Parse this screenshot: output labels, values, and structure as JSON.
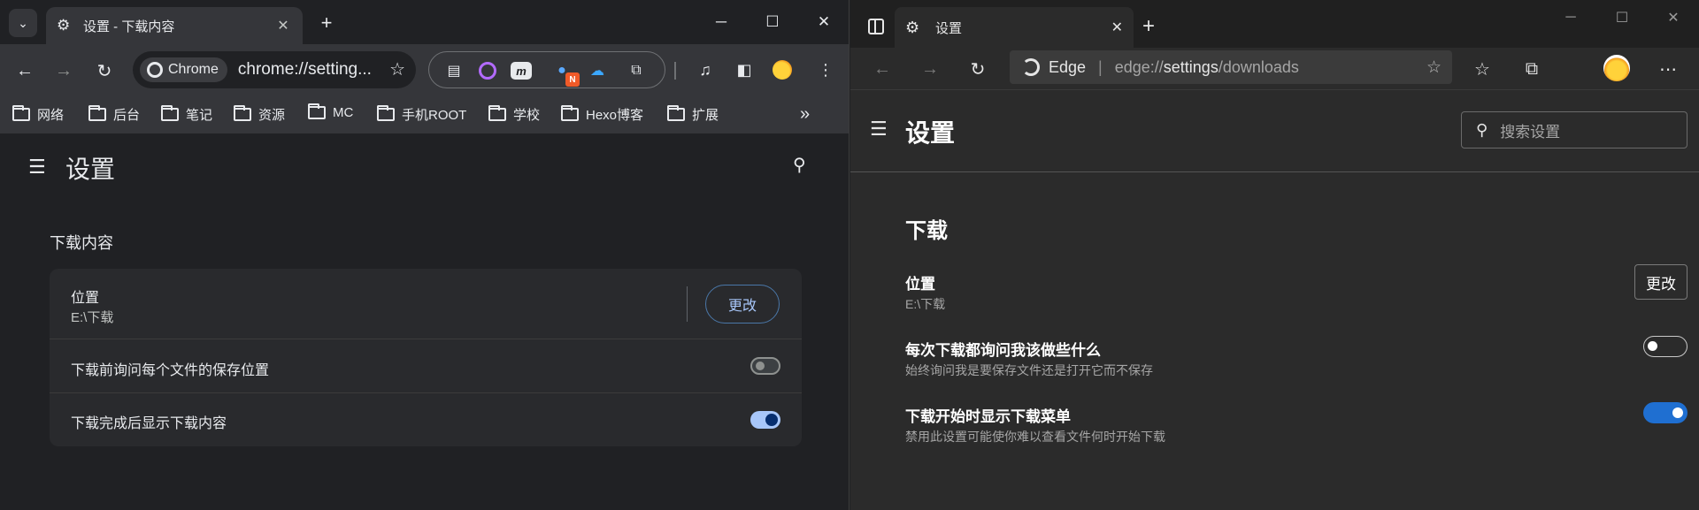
{
  "chrome": {
    "tab": {
      "title": "设置 - 下载内容",
      "icon": "gear-icon"
    },
    "omnibox": {
      "chip_label": "Chrome",
      "url": "chrome://setting..."
    },
    "bookmarks": [
      "网络",
      "后台",
      "笔记",
      "资源",
      "MC",
      "手机ROOT",
      "学校",
      "Hexo博客",
      "扩展"
    ],
    "page": {
      "title": "设置",
      "section": "下载内容",
      "location_label": "位置",
      "location_value": "E:\\下载",
      "change_button": "更改",
      "ask_label": "下载前询问每个文件的保存位置",
      "ask_enabled": false,
      "show_label": "下载完成后显示下载内容",
      "show_enabled": true
    },
    "extensions": {
      "badge": "N"
    },
    "colors": {
      "accent": "#a8c7fa",
      "toggle_knob": "#062e6f",
      "frame": "#35363a",
      "page_bg": "#202124"
    }
  },
  "edge": {
    "tab": {
      "title": "设置",
      "icon": "gear-icon"
    },
    "address": {
      "brand": "Edge",
      "url_prefix": "edge://",
      "url_main": "settings",
      "url_suffix": "/downloads"
    },
    "page": {
      "title": "设置",
      "search_placeholder": "搜索设置",
      "section": "下载",
      "location_label": "位置",
      "location_value": "E:\\下载",
      "change_button": "更改",
      "ask_label": "每次下载都询问我该做些什么",
      "ask_sub": "始终询问我是要保存文件还是打开它而不保存",
      "ask_enabled": false,
      "menu_label": "下载开始时显示下载菜单",
      "menu_sub": "禁用此设置可能使你难以查看文件何时开始下载",
      "menu_enabled": true
    },
    "colors": {
      "accent": "#1f6fd1",
      "page_bg": "#2b2b2b"
    }
  }
}
